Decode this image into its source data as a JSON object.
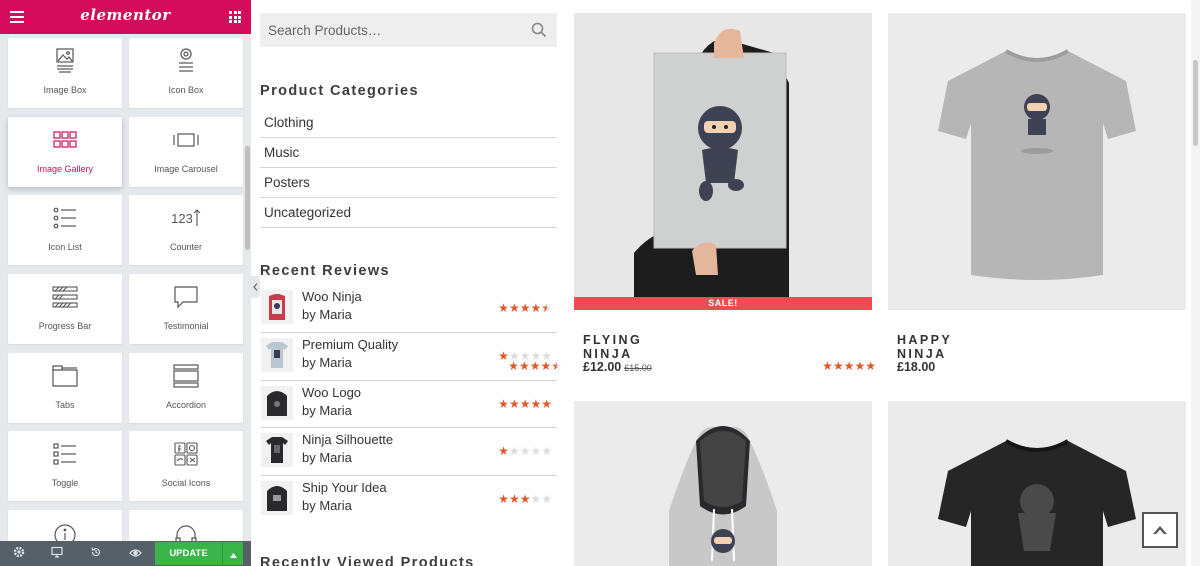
{
  "editor": {
    "logo": "elementor",
    "widgets": [
      {
        "label": "Image Box",
        "icon": "image-box-icon"
      },
      {
        "label": "Icon Box",
        "icon": "icon-box-icon"
      },
      {
        "label": "Image Gallery",
        "icon": "image-gallery-icon"
      },
      {
        "label": "Image Carousel",
        "icon": "image-carousel-icon"
      },
      {
        "label": "Icon List",
        "icon": "icon-list-icon"
      },
      {
        "label": "Counter",
        "icon": "counter-icon"
      },
      {
        "label": "Progress Bar",
        "icon": "progress-bar-icon"
      },
      {
        "label": "Testimonial",
        "icon": "testimonial-icon"
      },
      {
        "label": "Tabs",
        "icon": "tabs-icon"
      },
      {
        "label": "Accordion",
        "icon": "accordion-icon"
      },
      {
        "label": "Toggle",
        "icon": "toggle-icon"
      },
      {
        "label": "Social Icons",
        "icon": "social-icons-icon"
      }
    ],
    "counter_glyph": "123",
    "update_label": "UPDATE",
    "accent_color": "#d30c5c",
    "update_color": "#39b54a"
  },
  "shop": {
    "search": {
      "placeholder": "Search Products…"
    },
    "categories_title": "Product Categories",
    "categories": [
      "Clothing",
      "Music",
      "Posters",
      "Uncategorized"
    ],
    "reviews_title": "Recent Reviews",
    "reviews": [
      {
        "name": "Woo Ninja",
        "by": "by Maria",
        "rating": 4.5
      },
      {
        "name": "Premium Quality",
        "by": "by Maria",
        "rating": 1
      },
      {
        "name": "Woo Logo",
        "by": "by Maria",
        "rating": 5
      },
      {
        "name": "Ninja Silhouette",
        "by": "by Maria",
        "rating": 1
      },
      {
        "name": "Ship Your Idea",
        "by": "by Maria",
        "rating": 3
      }
    ],
    "recently_viewed_title": "Recently Viewed Products",
    "star_color": "#e0592a"
  },
  "products": [
    {
      "name": "FLYING NINJA",
      "price": "£12.00",
      "old_price": "£15.00",
      "badge": "SALE!",
      "rating": 4.5
    },
    {
      "name": "HAPPY NINJA",
      "price": "£18.00",
      "rating": 5
    }
  ]
}
